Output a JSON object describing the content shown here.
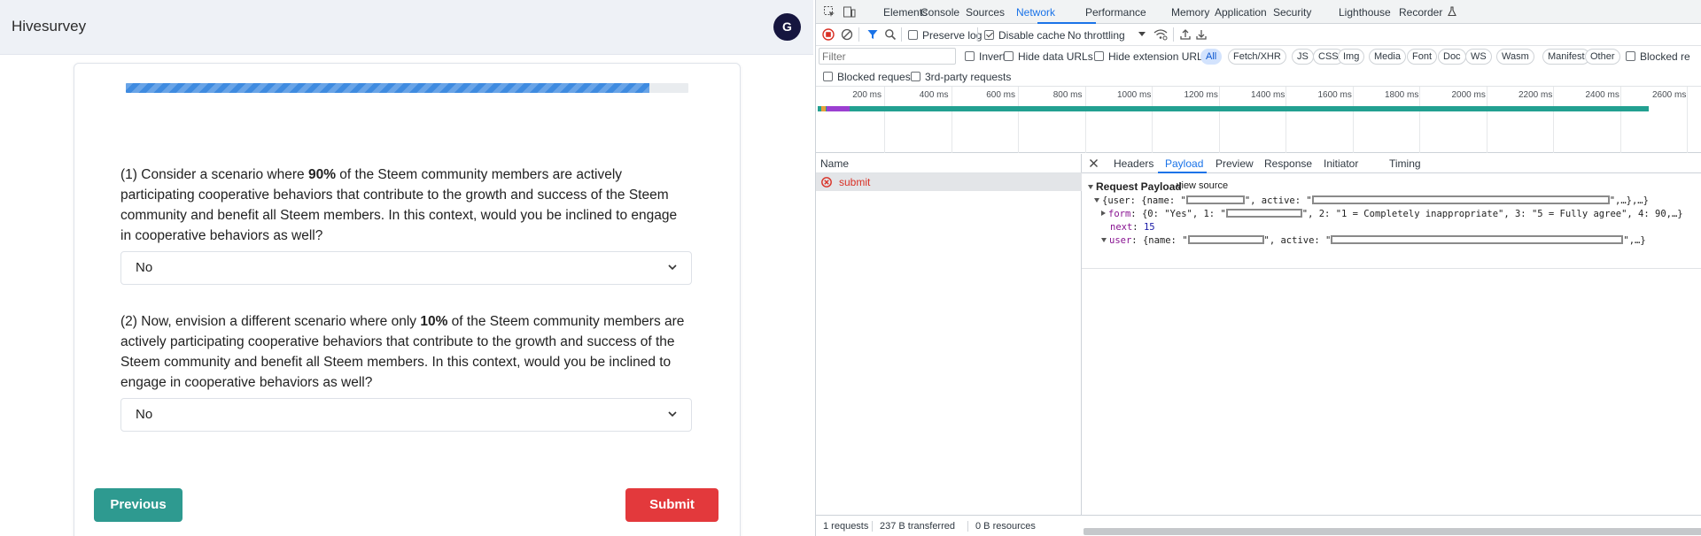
{
  "app": {
    "brand": "Hivesurvey",
    "avatar_initial": "G",
    "progress_fraction": 0.93,
    "questions": [
      {
        "number": "(1)",
        "text_before": "Consider a scenario where ",
        "emphasis": "90%",
        "text_after": " of the Steem community members are actively participating cooperative behaviors that contribute to the growth and success of the Steem community and benefit all Steem members. In this context, would you be inclined to engage in cooperative behaviors as well?",
        "answer": "No"
      },
      {
        "number": "(2)",
        "text_before": "Now, envision a different scenario where only ",
        "emphasis": "10%",
        "text_after": " of the Steem community members are actively participating cooperative behaviors that contribute to the growth and success of the Steem community and benefit all Steem members. In this context, would you be inclined to engage in cooperative behaviors as well?",
        "answer": "No"
      }
    ],
    "buttons": {
      "previous": "Previous",
      "submit": "Submit"
    },
    "colors": {
      "header_bg": "#eef1f6",
      "previous": "#2e9a90",
      "submit": "#e3393c",
      "progress": "#3f8be0",
      "avatar": "#16163f"
    }
  },
  "devtools": {
    "tabs": [
      "Elements",
      "Console",
      "Sources",
      "Network",
      "Performance",
      "Memory",
      "Application",
      "Security",
      "Lighthouse",
      "Recorder"
    ],
    "active_tab": "Network",
    "toolbar": {
      "preserve_log": "Preserve log",
      "disable_cache": "Disable cache",
      "throttling": "No throttling"
    },
    "filter": {
      "placeholder": "Filter",
      "invert": "Invert",
      "hide_data_urls": "Hide data URLs",
      "hide_extension_urls": "Hide extension URLs",
      "types": [
        "All",
        "Fetch/XHR",
        "JS",
        "CSS",
        "Img",
        "Media",
        "Font",
        "Doc",
        "WS",
        "Wasm",
        "Manifest",
        "Other"
      ],
      "active_type": "All",
      "blocked_cookies": "Blocked re",
      "blocked_requests": "Blocked requests",
      "third_party": "3rd-party requests"
    },
    "timeline_ticks": [
      "200 ms",
      "400 ms",
      "600 ms",
      "800 ms",
      "1000 ms",
      "1200 ms",
      "1400 ms",
      "1600 ms",
      "1800 ms",
      "2000 ms",
      "2200 ms",
      "2400 ms",
      "2600 ms"
    ],
    "name_header": "Name",
    "requests": [
      {
        "name": "submit",
        "status": "error"
      }
    ],
    "detail_tabs": [
      "Headers",
      "Payload",
      "Preview",
      "Response",
      "Initiator",
      "Timing"
    ],
    "active_detail_tab": "Payload",
    "payload": {
      "title": "Request Payload",
      "view_source": "view source",
      "line1_a": "{user: {name: \"",
      "line1_b": "\", active: \"",
      "line1_c": "\",…},…}",
      "line2_key": "form",
      "line2_a": ": {0: \"Yes\", 1: \"",
      "line2_b": "\", 2: \"1 = Completely inappropriate\", 3: \"5 = Fully agree\", 4: 90,…}",
      "line3_key": "next",
      "line3_value": "15",
      "line4_key": "user",
      "line4_a": ": {name: \"",
      "line4_b": "\", active: \"",
      "line4_c": "\",…}"
    },
    "status": {
      "requests": "1 requests",
      "transferred": "237 B transferred",
      "resources": "0 B resources"
    }
  }
}
